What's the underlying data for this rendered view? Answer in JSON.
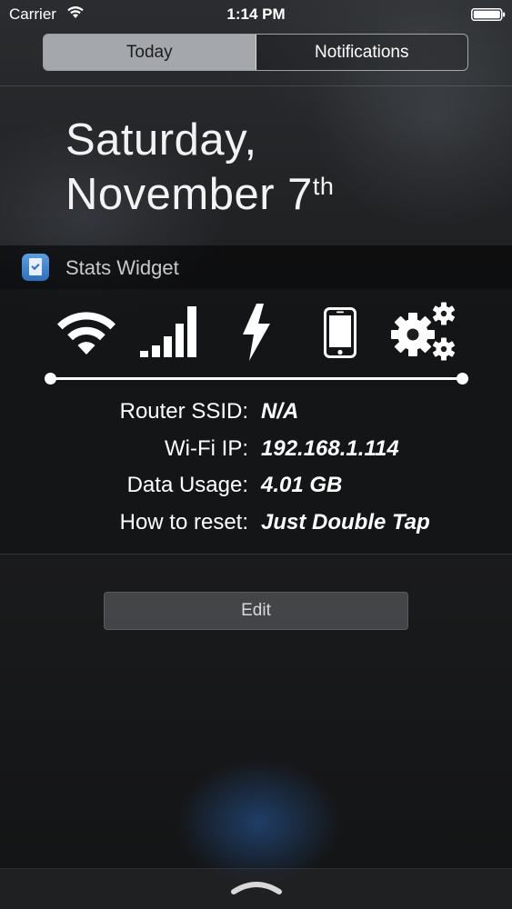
{
  "status_bar": {
    "carrier": "Carrier",
    "time": "1:14 PM",
    "icons": [
      "wifi-icon",
      "battery-icon"
    ]
  },
  "segmented_control": {
    "tabs": [
      {
        "label": "Today",
        "selected": true
      },
      {
        "label": "Notifications",
        "selected": false
      }
    ]
  },
  "date": {
    "weekday": "Saturday,",
    "month_day": "November 7",
    "ordinal_suffix": "th"
  },
  "widget": {
    "title": "Stats Widget",
    "app_icon": "stats-widget-app-icon",
    "icons": [
      "wifi-icon",
      "cellular-signal-icon",
      "bolt-icon",
      "phone-icon",
      "gears-icon"
    ],
    "stats": [
      {
        "label": "Router SSID:",
        "value": "N/A"
      },
      {
        "label": "Wi-Fi IP:",
        "value": "192.168.1.114"
      },
      {
        "label": "Data Usage:",
        "value": "4.01 GB"
      },
      {
        "label": "How to reset:",
        "value": "Just Double Tap"
      }
    ]
  },
  "edit_button": {
    "label": "Edit"
  },
  "bottom_bar": {
    "icon": "chevron-up-grabber-icon"
  },
  "colors": {
    "text": "#ffffff",
    "selected_tab_bg": "#c8cbd0",
    "background": "#1a1b1c"
  }
}
